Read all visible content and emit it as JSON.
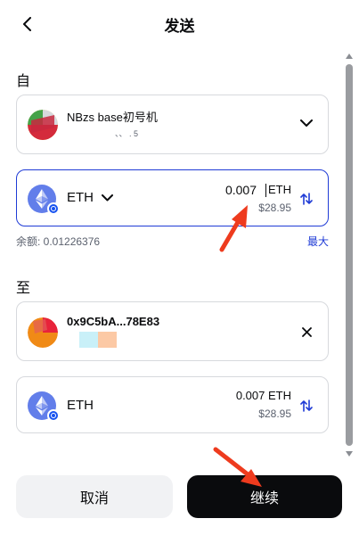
{
  "header": {
    "title": "发送"
  },
  "from": {
    "label": "自",
    "wallet_name": "NBzs base初号机",
    "wallet_sub": "、、 . 5"
  },
  "amount_card": {
    "token": "ETH",
    "amount": "0.007",
    "amount_unit": "ETH",
    "fiat": "$28.95"
  },
  "balance": {
    "label": "余额: 0.01226376",
    "max_label": "最大"
  },
  "to": {
    "label": "至",
    "address": "0x9C5bA...78E83"
  },
  "summary_card": {
    "token": "ETH",
    "amount": "0.007 ETH",
    "fiat": "$28.95"
  },
  "actions": {
    "cancel_label": "取消",
    "continue_label": "继续"
  },
  "colors": {
    "accent": "#1f3bd6",
    "eth": "#627eea",
    "annotation": "#ee3b1e"
  },
  "icons": [
    "back-icon",
    "chevron-down-icon",
    "swap-icon",
    "close-icon",
    "eth-icon"
  ]
}
